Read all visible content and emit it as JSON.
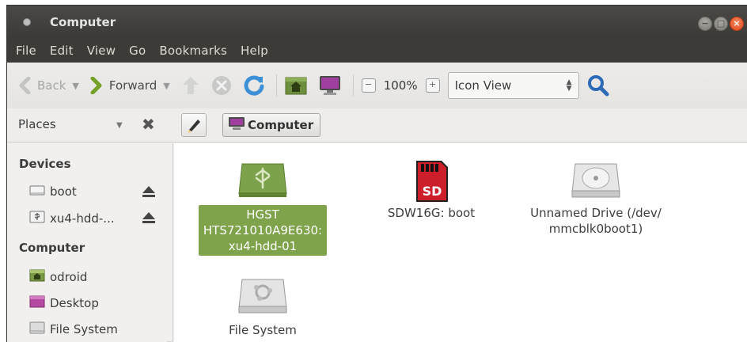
{
  "window": {
    "title": "Computer",
    "controls": [
      "minimize",
      "maximize",
      "close"
    ]
  },
  "menubar": {
    "items": [
      "File",
      "Edit",
      "View",
      "Go",
      "Bookmarks",
      "Help"
    ]
  },
  "toolbar": {
    "back_label": "Back",
    "forward_label": "Forward",
    "zoom_level": "100%",
    "view_mode": "Icon View"
  },
  "locationbar": {
    "places_label": "Places",
    "path_button_label": "Computer"
  },
  "sidebar": {
    "sections": [
      {
        "title": "Devices",
        "items": [
          {
            "label": "boot",
            "icon": "drive-icon",
            "ejectable": true
          },
          {
            "label": "xu4-hdd-...",
            "icon": "usb-drive-icon",
            "ejectable": true
          }
        ]
      },
      {
        "title": "Computer",
        "items": [
          {
            "label": "odroid",
            "icon": "home-folder-icon"
          },
          {
            "label": "Desktop",
            "icon": "desktop-icon"
          },
          {
            "label": "File System",
            "icon": "filesystem-icon"
          }
        ]
      }
    ]
  },
  "main": {
    "items": [
      {
        "label": "HGST\nHTS721010A9E630:\nxu4-hdd-01",
        "lines": [
          "HGST",
          "HTS721010A9E630:",
          "xu4-hdd-01"
        ],
        "icon": "usb-drive-icon",
        "selected": true
      },
      {
        "label": "SDW16G: boot",
        "lines": [
          "SDW16G: boot"
        ],
        "icon": "sd-card-icon",
        "selected": false
      },
      {
        "label": "Unnamed Drive (/dev/\nmmcblk0boot1)",
        "lines": [
          "Unnamed Drive (/dev/",
          "mmcblk0boot1)"
        ],
        "icon": "hard-drive-icon",
        "selected": false
      },
      {
        "label": "File System",
        "lines": [
          "File System"
        ],
        "icon": "filesystem-icon",
        "selected": false
      }
    ]
  },
  "colors": {
    "titlebar": "#3c3b37",
    "selection": "#7fa34b",
    "close_button": "#e0491d"
  }
}
